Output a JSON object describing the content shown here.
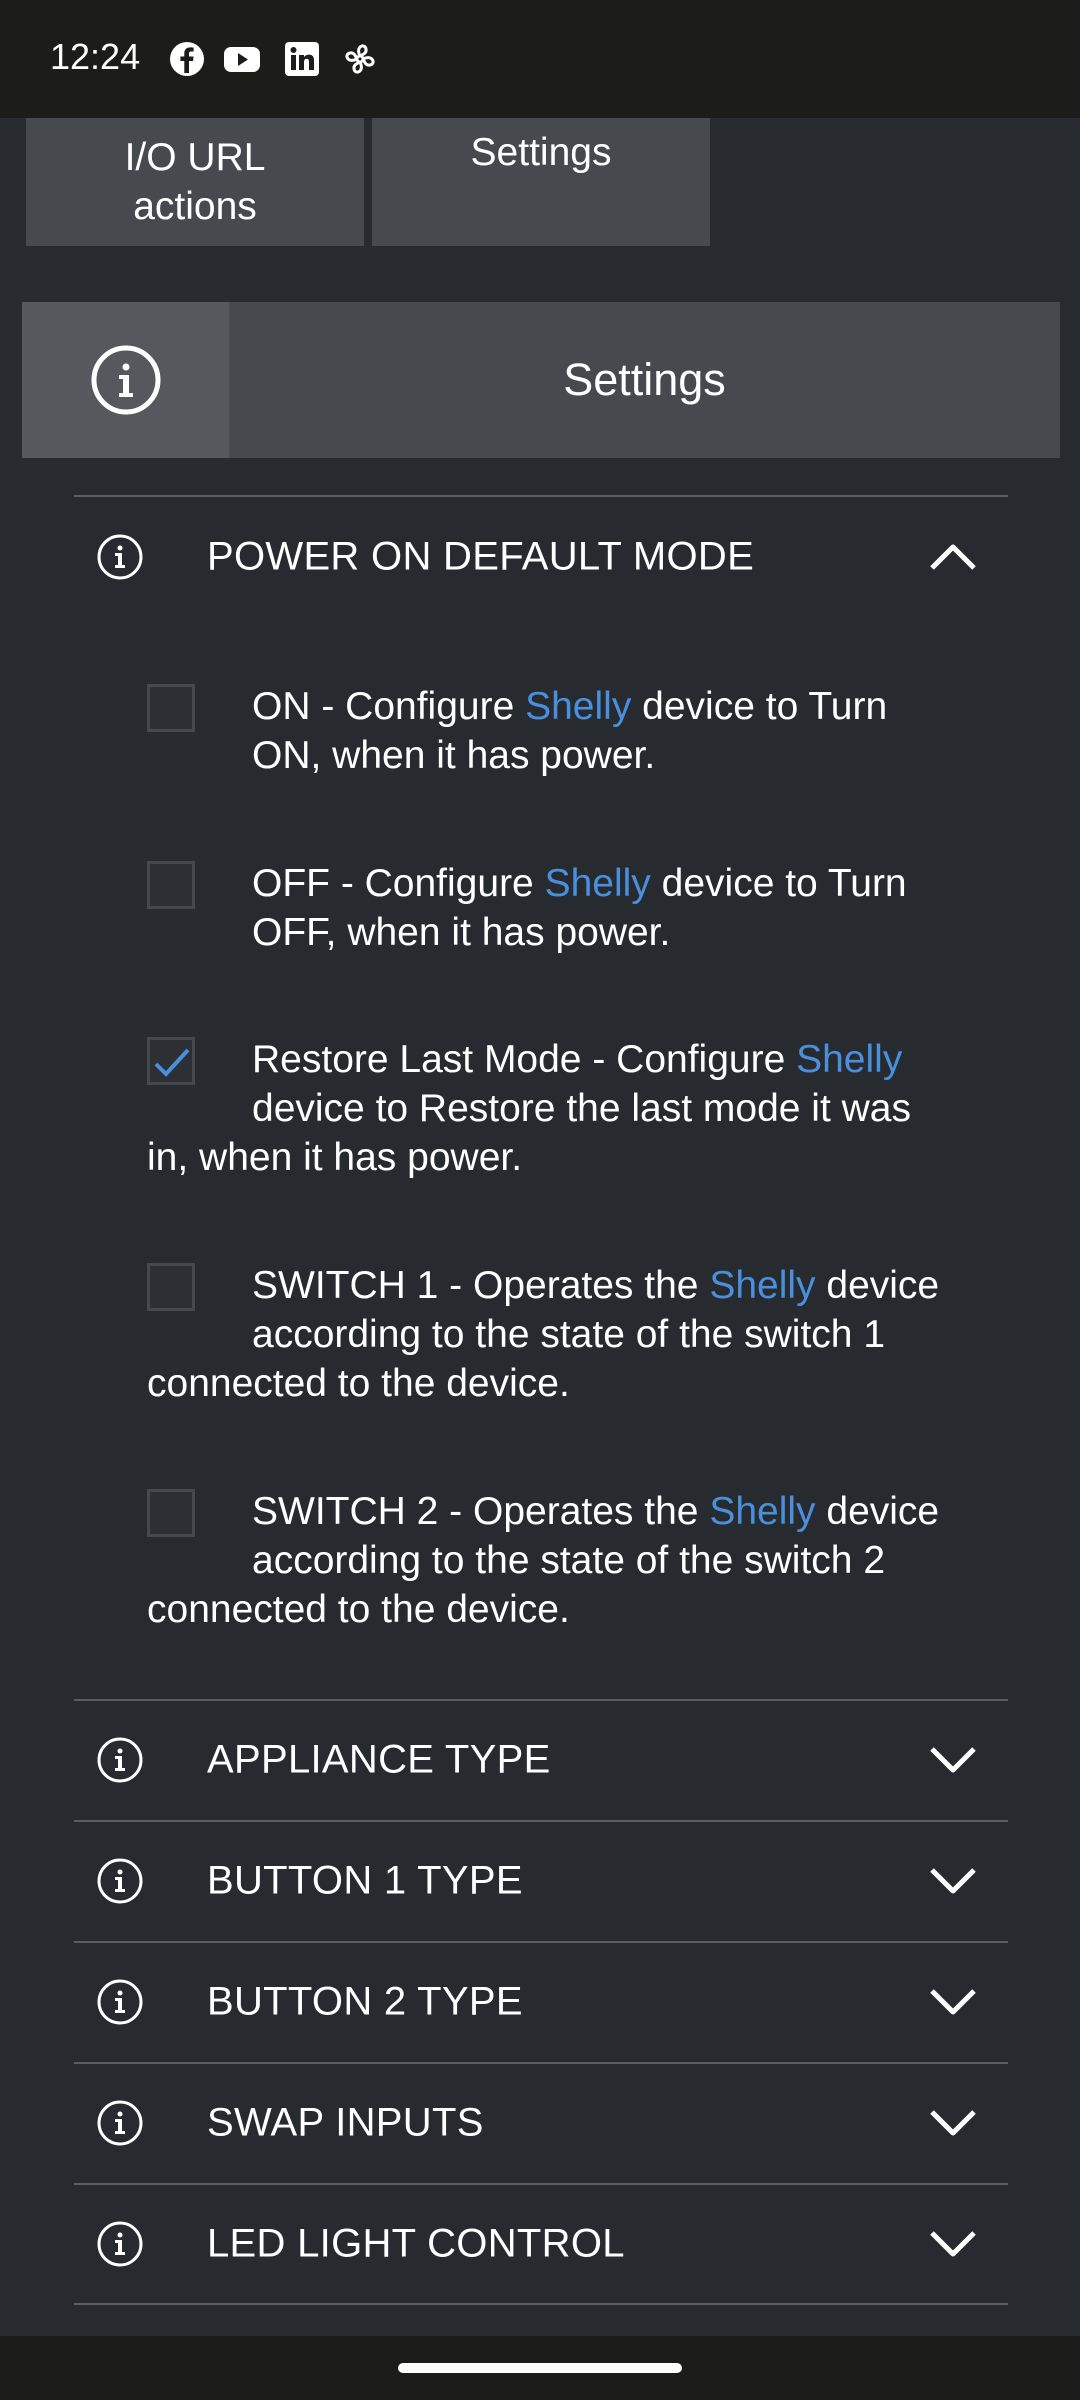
{
  "status_bar": {
    "time": "12:24",
    "icons": [
      "facebook-icon",
      "youtube-icon",
      "linkedin-icon",
      "fan-icon"
    ]
  },
  "top_tabs": [
    {
      "label": "I/O URL\nactions"
    },
    {
      "label": "Settings"
    }
  ],
  "header": {
    "title": "Settings",
    "icon": "info-icon"
  },
  "power_on_section": {
    "label": "POWER ON DEFAULT MODE",
    "expanded": true,
    "options": [
      {
        "prefix": "ON - Configure ",
        "brand": "Shelly",
        "suffix": " device to Turn ON, when it has power.",
        "checked": false
      },
      {
        "prefix": "OFF - Configure ",
        "brand": "Shelly",
        "suffix": " device to Turn OFF, when it has power.",
        "checked": false
      },
      {
        "prefix": "Restore Last Mode - Configure ",
        "brand": "Shelly",
        "suffix": " device to Restore the last mode it was in, when it has power.",
        "checked": true
      },
      {
        "prefix": "SWITCH 1 - Operates the ",
        "brand": "Shelly",
        "suffix": " device according to the state of the switch 1 connected to the device.",
        "checked": false
      },
      {
        "prefix": "SWITCH 2 - Operates the ",
        "brand": "Shelly",
        "suffix": " device according to the state of the switch 2 connected to the device.",
        "checked": false
      }
    ]
  },
  "collapsed_sections": [
    {
      "label": "APPLIANCE TYPE"
    },
    {
      "label": "BUTTON 1 TYPE"
    },
    {
      "label": "BUTTON 2 TYPE"
    },
    {
      "label": "SWAP INPUTS"
    },
    {
      "label": "LED LIGHT CONTROL"
    }
  ],
  "colors": {
    "background": "#272b2f",
    "panel": "#464a4e",
    "accent": "#4a8fdc",
    "status_bar": "#1c1c1a"
  }
}
